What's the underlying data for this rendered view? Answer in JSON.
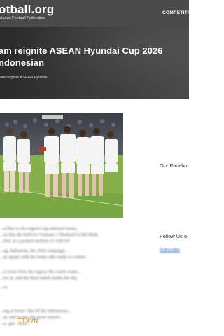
{
  "header": {
    "logo_title": "otball.org",
    "logo_subtitle": "Asean Football Federation",
    "nav": [
      "COMPETITI"
    ]
  },
  "hero": {
    "title": "am reignite ASEAN Hyundai Cup 2026 ndonesian",
    "breadcrumb": "am reignite ASEAN Hyundai..."
  },
  "sidebar": {
    "facebook_label": "Our Facebo",
    "follow_label": "Follow Us o",
    "follow_link": "Subscribe"
  },
  "article": {
    "paragraphs": [
      [
        "...n blue as the region's top national teams,",
        "...en hits the field for Vietnam v Thailand in Mỹ Đình,",
        "...iled, in a packed stadium of ASEAN"
      ],
      [
        "...ng, Indonesia, the 2026 campaign...",
        "...nt squad, with the home side ready to contest"
      ],
      [
        "...y rivals from the region; the coach wants...",
        "...ers in, and the final match marks the day"
      ],
      [
        "...ea"
      ],
      [
        "...ing at home: like all the Indonesian...",
        "...nt, and so into the great season...",
        "...a...gin...final..."
      ]
    ],
    "watermark": "TTXVN"
  },
  "colors": {
    "header_bg": "#4a4a4a",
    "hero_bg": "#2f2f2f",
    "link": "#1d57b8",
    "pitch": "#86b14a",
    "jersey": "#f4f4f4",
    "watermark": "#e0a33a"
  }
}
